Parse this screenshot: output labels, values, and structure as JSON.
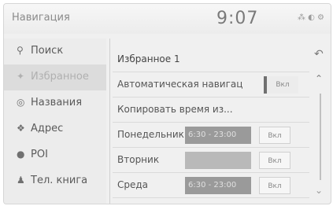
{
  "header": {
    "title": "Навигация",
    "time": "9:07",
    "status": "⁂ ◐ ⚙"
  },
  "sidebar": {
    "items": [
      {
        "label": "Поиск",
        "icon": "search-icon",
        "glyph": "🔍"
      },
      {
        "label": "Избранное",
        "icon": "star-icon",
        "glyph": "★"
      },
      {
        "label": "Названия",
        "icon": "poi-name-icon",
        "glyph": "◎"
      },
      {
        "label": "Адрес",
        "icon": "address-icon",
        "glyph": "✦"
      },
      {
        "label": "POI",
        "icon": "pin-icon",
        "glyph": "⬤"
      },
      {
        "label": "Тел. книга",
        "icon": "person-icon",
        "glyph": "👤"
      }
    ]
  },
  "main": {
    "title": "Избранное 1",
    "auto_nav_label": "Автоматическая навигац",
    "auto_nav_state": "Вкл",
    "copy_time_label": "Копировать время из...",
    "days": [
      {
        "label": "Понедельник",
        "time": "6:30 - 23:00",
        "state": "Вкл"
      },
      {
        "label": "Вторник",
        "time": "",
        "state": "Вкл"
      },
      {
        "label": "Среда",
        "time": "6:30 - 23:00",
        "state": "Вкл"
      }
    ]
  },
  "rail": {
    "back": "↶",
    "up": "⌃",
    "down": "⌄"
  }
}
